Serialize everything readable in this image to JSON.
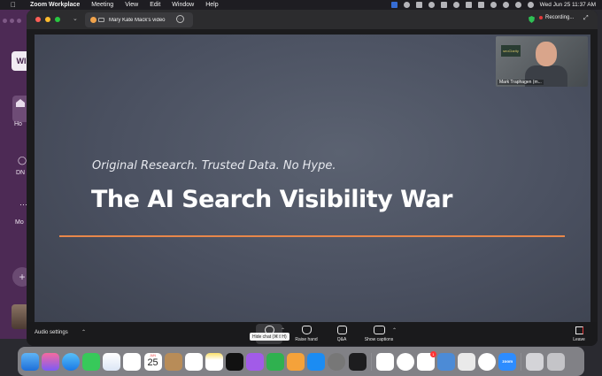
{
  "menubar": {
    "app_name": "Zoom Workplace",
    "menus": [
      "Meeting",
      "View",
      "Edit",
      "Window",
      "Help"
    ],
    "datetime": "Wed Jun 25  11:37 AM"
  },
  "background_app": {
    "logo": "WI",
    "nav_labels": [
      "Ho",
      "DN",
      "Mo"
    ]
  },
  "window": {
    "tab_title": "Mary Kate Mack's video",
    "recording_label": "Recording..."
  },
  "slide": {
    "subtitle": "Original Research. Trusted Data. No Hype.",
    "title": "The AI Search Visibility War",
    "accent_color": "#e8874a"
  },
  "self_view": {
    "name": "Mark Traphagen (m...",
    "sign_text": "seoClarity"
  },
  "toolbar": {
    "audio_settings": "Audio settings",
    "buttons": [
      {
        "label": "Chat",
        "icon": "chat-icon"
      },
      {
        "label": "Raise hand",
        "icon": "hand-icon"
      },
      {
        "label": "Q&A",
        "icon": "qa-icon"
      },
      {
        "label": "Show captions",
        "icon": "cc-icon"
      }
    ],
    "leave": "Leave",
    "tooltip": "Hide chat (⌘⇧H)"
  },
  "dock": {
    "calendar_month": "JUN",
    "calendar_day": "25",
    "zoom_label": "zoom",
    "slack_badge": "1"
  }
}
